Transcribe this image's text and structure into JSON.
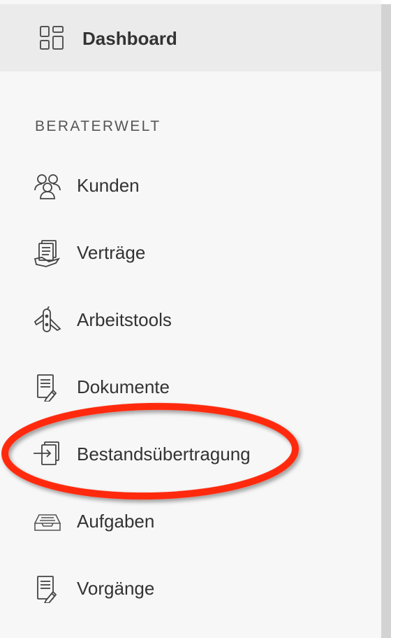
{
  "header": {
    "dashboard_label": "Dashboard",
    "dashboard_icon": "dashboard-grid-icon"
  },
  "section": {
    "title": "BERATERWELT"
  },
  "nav": {
    "items": [
      {
        "label": "Kunden",
        "icon": "people-group-icon"
      },
      {
        "label": "Verträge",
        "icon": "contract-stack-icon"
      },
      {
        "label": "Arbeitstools",
        "icon": "pocket-knife-icon"
      },
      {
        "label": "Dokumente",
        "icon": "document-edit-icon"
      },
      {
        "label": "Bestandsübertragung",
        "icon": "document-transfer-icon"
      },
      {
        "label": "Aufgaben",
        "icon": "inbox-tray-icon"
      },
      {
        "label": "Vorgänge",
        "icon": "document-edit-icon"
      }
    ]
  },
  "annotation": {
    "highlighted_item": "Bestandsübertragung",
    "color": "#ff2a10"
  },
  "colors": {
    "sidebar_bg": "#f7f7f7",
    "active_bg": "#ebebeb",
    "text": "#333333",
    "scrollbar": "#d3d3d3"
  }
}
